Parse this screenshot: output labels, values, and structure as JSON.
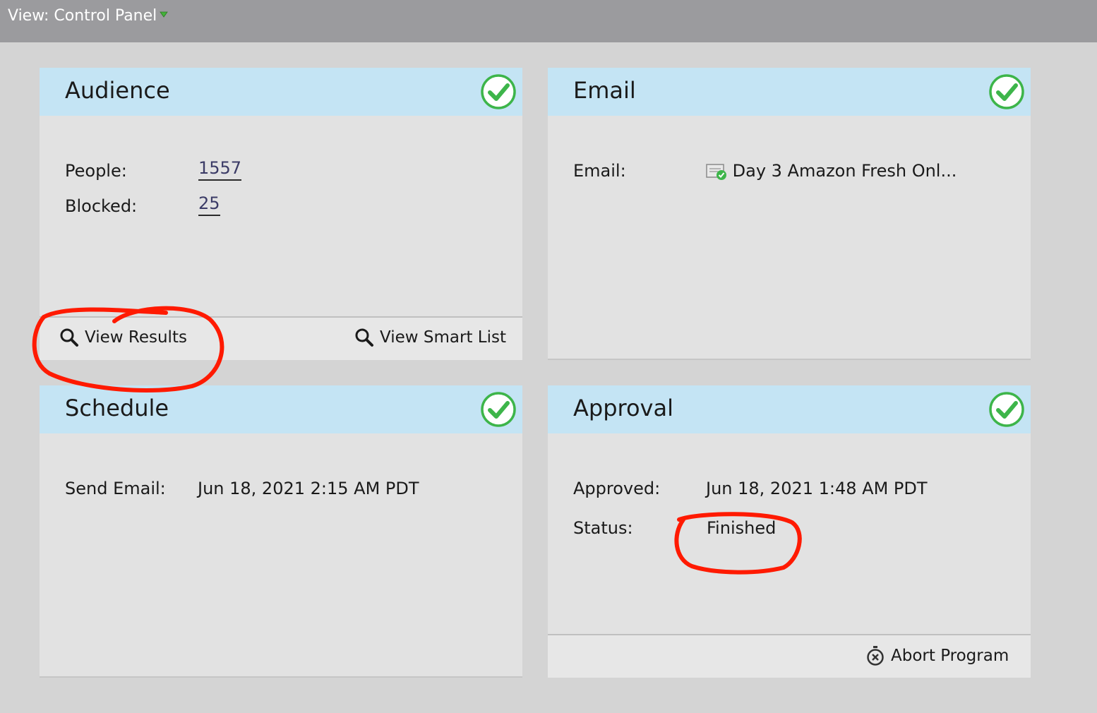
{
  "header": {
    "view_label": "View: Control Panel"
  },
  "audience": {
    "title": "Audience",
    "people_label": "People:",
    "people_value": "1557",
    "blocked_label": "Blocked:",
    "blocked_value": "25",
    "view_results": "View Results",
    "view_smart_list": "View Smart List"
  },
  "email": {
    "title": "Email",
    "email_label": "Email:",
    "email_value": "Day 3 Amazon Fresh Onl..."
  },
  "schedule": {
    "title": "Schedule",
    "send_label": "Send Email:",
    "send_value": "Jun 18, 2021 2:15 AM PDT"
  },
  "approval": {
    "title": "Approval",
    "approved_label": "Approved:",
    "approved_value": "Jun 18, 2021 1:48 AM PDT",
    "status_label": "Status:",
    "status_value": "Finished",
    "abort": "Abort Program"
  },
  "icons": {
    "check": "check-circle-icon",
    "search": "magnifier-icon",
    "email": "email-document-icon",
    "abort": "stopwatch-x-icon",
    "caret": "caret-down-icon"
  },
  "colors": {
    "panel_header": "#c4e4f4",
    "check_green": "#3db54a",
    "annotation_red": "#ff1a00",
    "link": "#3b3b66"
  }
}
